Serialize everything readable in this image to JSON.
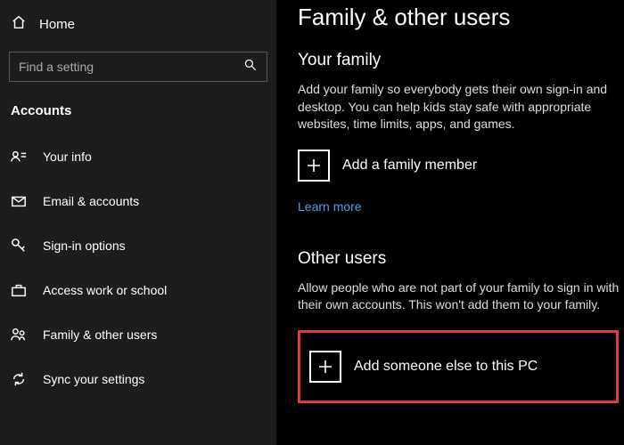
{
  "sidebar": {
    "home": "Home",
    "search_placeholder": "Find a setting",
    "category": "Accounts",
    "items": [
      {
        "label": "Your info"
      },
      {
        "label": "Email & accounts"
      },
      {
        "label": "Sign-in options"
      },
      {
        "label": "Access work or school"
      },
      {
        "label": "Family & other users"
      },
      {
        "label": "Sync your settings"
      }
    ]
  },
  "main": {
    "title": "Family & other users",
    "family": {
      "heading": "Your family",
      "body": "Add your family so everybody gets their own sign-in and desktop. You can help kids stay safe with appropriate websites, time limits, apps, and games.",
      "add_label": "Add a family member",
      "link": "Learn more"
    },
    "other": {
      "heading": "Other users",
      "body": "Allow people who are not part of your family to sign in with their own accounts. This won't add them to your family.",
      "add_label": "Add someone else to this PC"
    }
  }
}
